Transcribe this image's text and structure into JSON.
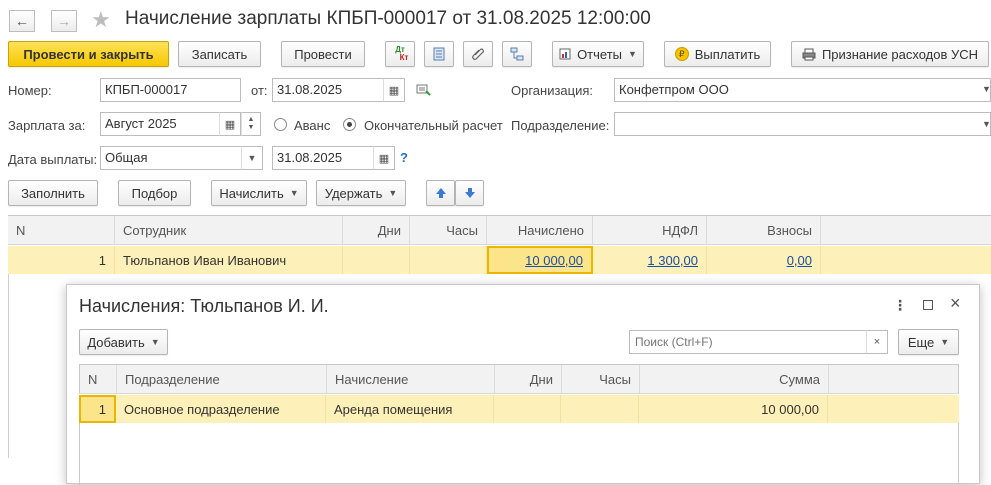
{
  "window": {
    "title": "Начисление зарплаты КПБП-000017 от 31.08.2025 12:00:00"
  },
  "toolbar": {
    "post_close": "Провести и закрыть",
    "save": "Записать",
    "post": "Провести",
    "dt_kt_top": "Дт",
    "dt_kt_bottom": "Кт",
    "reports": "Отчеты",
    "pay": "Выплатить",
    "usn": "Признание расходов УСН"
  },
  "form": {
    "number_label": "Номер:",
    "number_value": "КПБП-000017",
    "from_label": "от:",
    "date_value": "31.08.2025",
    "org_label": "Организация:",
    "org_value": "Конфетпром ООО",
    "salary_for_label": "Зарплата за:",
    "month_value": "Август 2025",
    "advance_label": "Аванс",
    "final_label": "Окончательный расчет",
    "dept_label": "Подразделение:",
    "dept_value": "",
    "pay_date_label": "Дата выплаты:",
    "pay_date_type": "Общая",
    "pay_date_value": "31.08.2025",
    "help": "?"
  },
  "actions": {
    "fill": "Заполнить",
    "select": "Подбор",
    "accrue": "Начислить",
    "deduct": "Удержать"
  },
  "table": {
    "columns": [
      "N",
      "Сотрудник",
      "Дни",
      "Часы",
      "Начислено",
      "НДФЛ",
      "Взносы"
    ],
    "rows": [
      {
        "n": "1",
        "employee": "Тюльпанов Иван Иванович",
        "days": "",
        "hours": "",
        "accrued": "10 000,00",
        "ndfl": "1 300,00",
        "contrib": "0,00"
      }
    ]
  },
  "popup": {
    "title": "Начисления: Тюльпанов И. И.",
    "add": "Добавить",
    "search_placeholder": "Поиск (Ctrl+F)",
    "clear": "×",
    "more": "Еще",
    "columns": [
      "N",
      "Подразделение",
      "Начисление",
      "Дни",
      "Часы",
      "Сумма"
    ],
    "rows": [
      {
        "n": "1",
        "dept": "Основное подразделение",
        "accrual": "Аренда помещения",
        "days": "",
        "hours": "",
        "sum": "10 000,00"
      }
    ]
  },
  "colors": {
    "primary_button": "#f6c800",
    "selected_row": "#fdf0b8",
    "link": "#1c4ea0",
    "arrow_button": "#3a7bd5"
  }
}
